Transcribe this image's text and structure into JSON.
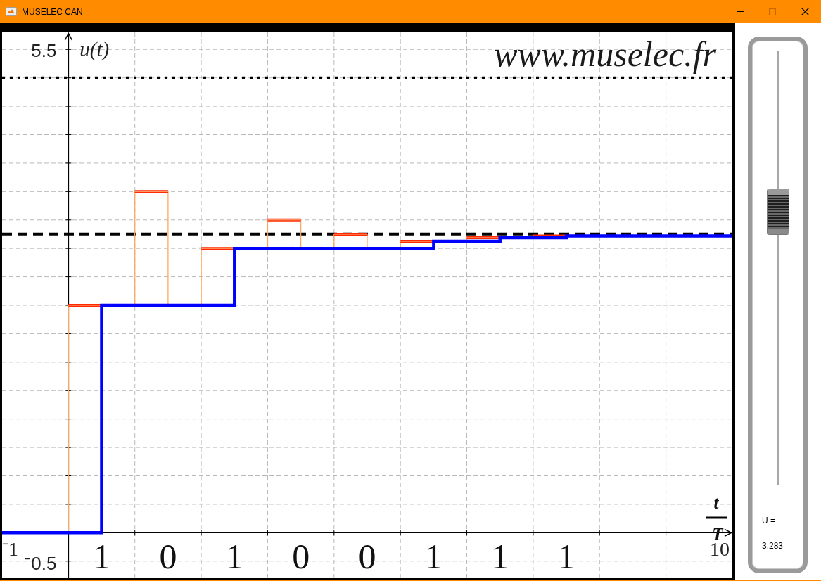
{
  "window": {
    "title": "MUSELEC CAN",
    "controls": [
      {
        "kind": "minimize",
        "disabled": false
      },
      {
        "kind": "maximize",
        "disabled": true
      },
      {
        "kind": "close",
        "disabled": false
      }
    ]
  },
  "graph": {
    "site_label": "www.muselec.fr",
    "y_axis_label": "u(t)",
    "x_axis_label": {
      "numerator": "t",
      "denominator": "T"
    },
    "bound_labels": {
      "ymax": "5.5",
      "xmin": "⁻1",
      "ymin": "⁻0.5",
      "xmax": "10"
    },
    "bits": [
      "1",
      "0",
      "1",
      "0",
      "0",
      "1",
      "1",
      "1"
    ]
  },
  "slider": {
    "level": 0.63,
    "label": "U =",
    "value": "3.283"
  }
}
